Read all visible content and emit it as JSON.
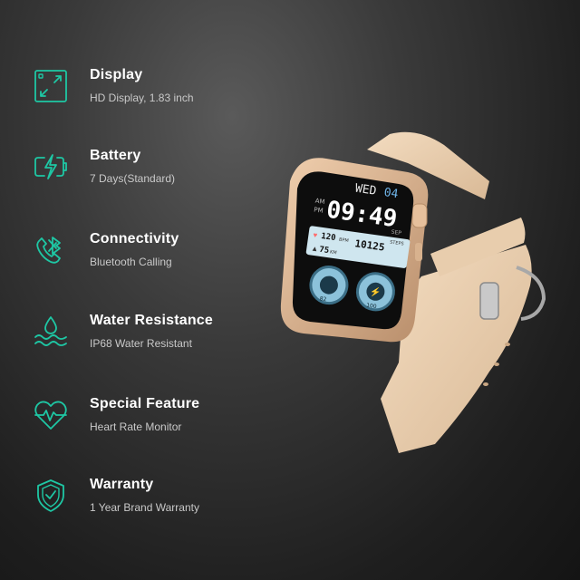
{
  "accent_color": "#1ec7a4",
  "features": [
    {
      "icon": "display-icon",
      "title": "Display",
      "subtitle": "HD Display, 1.83 inch"
    },
    {
      "icon": "battery-icon",
      "title": "Battery",
      "subtitle": "7 Days(Standard)"
    },
    {
      "icon": "bluetooth-call-icon",
      "title": "Connectivity",
      "subtitle": "Bluetooth Calling"
    },
    {
      "icon": "water-drop-icon",
      "title": "Water Resistance",
      "subtitle": "IP68 Water Resistant"
    },
    {
      "icon": "heart-rate-icon",
      "title": "Special Feature",
      "subtitle": "Heart Rate Monitor"
    },
    {
      "icon": "shield-check-icon",
      "title": "Warranty",
      "subtitle": "1 Year Brand Warranty"
    }
  ],
  "watch": {
    "day": "WED",
    "date": "04",
    "ampm_top": "AM",
    "ampm_bottom": "PM",
    "time": "09:49",
    "sep_label": "SEP",
    "heart_rate": "120",
    "heart_unit": "BPM",
    "steps": "10125",
    "steps_label": "STEPS",
    "kcal": "75",
    "kcal_unit": "KM",
    "dial_left": "82",
    "dial_right": "100"
  }
}
